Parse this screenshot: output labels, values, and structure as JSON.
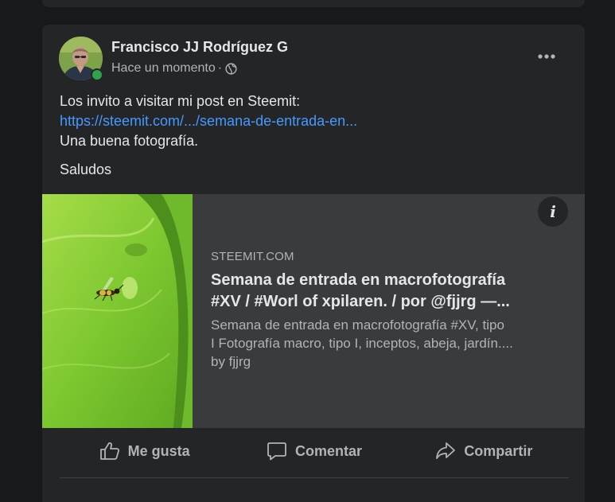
{
  "post": {
    "author": "Francisco JJ Rodríguez G",
    "timestamp": "Hace un momento",
    "separator": "·",
    "privacy_icon": "globe-icon",
    "more_icon": "more-horizontal-icon",
    "text_line1": "Los invito a visitar mi post en Steemit:",
    "link": "https://steemit.com/.../semana-de-entrada-en...",
    "text_line2": "Una buena fotografía.",
    "text_line3": "Saludos"
  },
  "link_preview": {
    "domain": "STEEMIT.COM",
    "title_line1": "Semana de entrada en macrofotografía",
    "title_line2": "#XV / #Worl of xpilaren. / por @fjjrg —...",
    "desc_line1": "Semana de entrada en macrofotografía #XV, tipo",
    "desc_line2": "I Fotografía macro, tipo I, inceptos, abeja, jardín....",
    "desc_line3": "by fjjrg",
    "info_label": "i"
  },
  "actions": {
    "like": "Me gusta",
    "comment": "Comentar",
    "share": "Compartir"
  },
  "colors": {
    "background": "#18191a",
    "card": "#242526",
    "preview": "#3a3b3c",
    "link": "#4599ff",
    "online": "#31a24c",
    "secondary_text": "#b0b3b8"
  }
}
